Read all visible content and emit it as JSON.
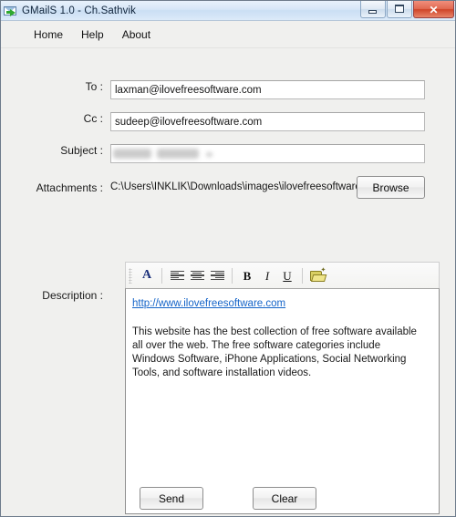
{
  "window": {
    "title": "GMailS 1.0 - Ch.Sathvik",
    "icon": "mail-send-icon",
    "controls": {
      "minimize": "minimize-icon",
      "maximize": "maximize-icon",
      "close": "✕"
    }
  },
  "menu": {
    "items": [
      {
        "label": "Home"
      },
      {
        "label": "Help"
      },
      {
        "label": "About"
      }
    ]
  },
  "form": {
    "to": {
      "label": "To :",
      "value": "laxman@ilovefreesoftware.com",
      "placeholder": ""
    },
    "cc": {
      "label": "Cc :",
      "value": "sudeep@ilovefreesoftware.com",
      "placeholder": ""
    },
    "subject": {
      "label": "Subject :",
      "value": "",
      "placeholder": "",
      "redacted": true
    },
    "attachments": {
      "label": "Attachments :",
      "path": "C:\\Users\\INKLIK\\Downloads\\images\\ilovefreesoftware.gif",
      "browse_label": "Browse"
    },
    "description": {
      "label": "Description :",
      "link": "http://www.ilovefreesoftware.com",
      "body": "This website has the best collection of free software available all over the web. The free software categories include Windows Software, iPhone Applications, Social Networking Tools, and software installation videos."
    }
  },
  "toolbar": {
    "buttons": [
      {
        "name": "font-color-icon",
        "glyph": "A"
      },
      {
        "name": "align-left-icon",
        "glyph": ""
      },
      {
        "name": "align-center-icon",
        "glyph": ""
      },
      {
        "name": "align-right-icon",
        "glyph": ""
      },
      {
        "name": "bold-icon",
        "glyph": "B"
      },
      {
        "name": "italic-icon",
        "glyph": "I"
      },
      {
        "name": "underline-icon",
        "glyph": "U"
      },
      {
        "name": "open-folder-icon",
        "glyph": ""
      }
    ]
  },
  "footer": {
    "send_label": "Send",
    "clear_label": "Clear"
  },
  "colors": {
    "window_bg": "#f0f0ee",
    "title_bg": "#d6e6f7",
    "border": "#6e7b8b",
    "close_btn": "#cf4428",
    "link": "#1464c8",
    "font_color_icon": "#1b2f7a",
    "folder_icon": "#d9cf62"
  }
}
